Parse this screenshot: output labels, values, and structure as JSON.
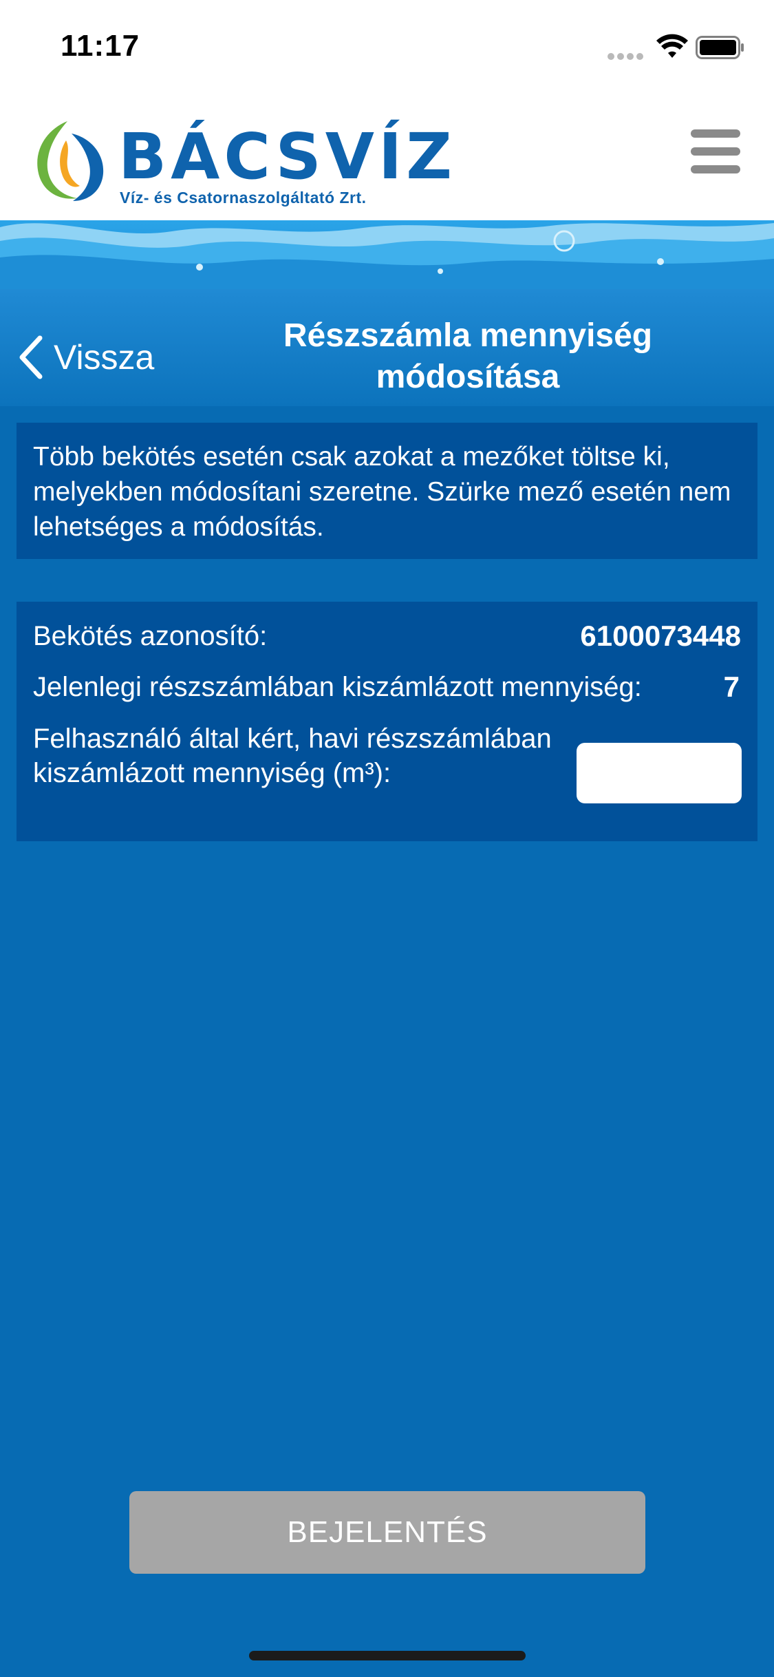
{
  "status_bar": {
    "time": "11:17"
  },
  "header": {
    "logo_title": "BÁCSVÍZ",
    "logo_subtitle": "Víz- és Csatornaszolgáltató Zrt.",
    "brand_color": "#0f63ad",
    "logo_green": "#6cb33f",
    "logo_orange": "#f5a623"
  },
  "nav": {
    "back_label": "Vissza",
    "title": "Részszámla mennyiség módosítása"
  },
  "info": {
    "text": "Több bekötés esetén csak azokat a mezőket töltse ki, melyekben módosítani szeretne. Szürke mező esetén nem lehetséges a módosítás."
  },
  "form": {
    "connection_id_label": "Bekötés azonosító:",
    "connection_id_value": "6100073448",
    "current_quantity_label": "Jelenlegi részszámlában kiszámlázott mennyiség:",
    "current_quantity_value": "7",
    "requested_quantity_label": "Felhasználó által kért, havi részszámlában kiszámlázott mennyiség (m³):",
    "requested_quantity_value": ""
  },
  "actions": {
    "submit_label": "BEJELENTÉS"
  },
  "colors": {
    "background": "#076bb3",
    "panel": "#01519a",
    "disabled_button": "#a6a6a6"
  }
}
